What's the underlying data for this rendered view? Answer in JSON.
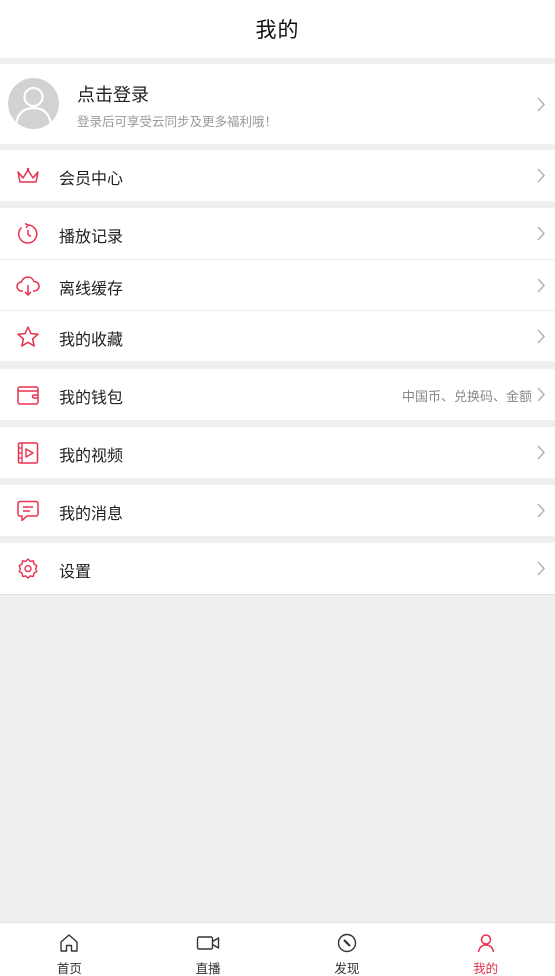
{
  "header": {
    "title": "我的"
  },
  "profile": {
    "login_title": "点击登录",
    "login_subtitle": "登录后可享受云同步及更多福利哦！"
  },
  "menu": {
    "vip": {
      "label": "会员中心",
      "icon": "crown-icon"
    },
    "history": {
      "label": "播放记录",
      "icon": "history-clock-icon"
    },
    "offline": {
      "label": "离线缓存",
      "icon": "cloud-download-icon"
    },
    "favorites": {
      "label": "我的收藏",
      "icon": "star-icon"
    },
    "wallet": {
      "label": "我的钱包",
      "extra": "中国币、兑换码、金额",
      "icon": "wallet-icon"
    },
    "videos": {
      "label": "我的视频",
      "icon": "video-file-icon"
    },
    "messages": {
      "label": "我的消息",
      "icon": "message-icon"
    },
    "settings": {
      "label": "设置",
      "icon": "gear-icon"
    }
  },
  "tabbar": {
    "items": [
      {
        "label": "首页",
        "icon": "home-icon",
        "active": false
      },
      {
        "label": "直播",
        "icon": "video-camera-icon",
        "active": false
      },
      {
        "label": "发现",
        "icon": "compass-icon",
        "active": false
      },
      {
        "label": "我的",
        "icon": "user-icon",
        "active": true
      }
    ]
  },
  "colors": {
    "accent": "#e8304e",
    "background": "#efefef"
  }
}
